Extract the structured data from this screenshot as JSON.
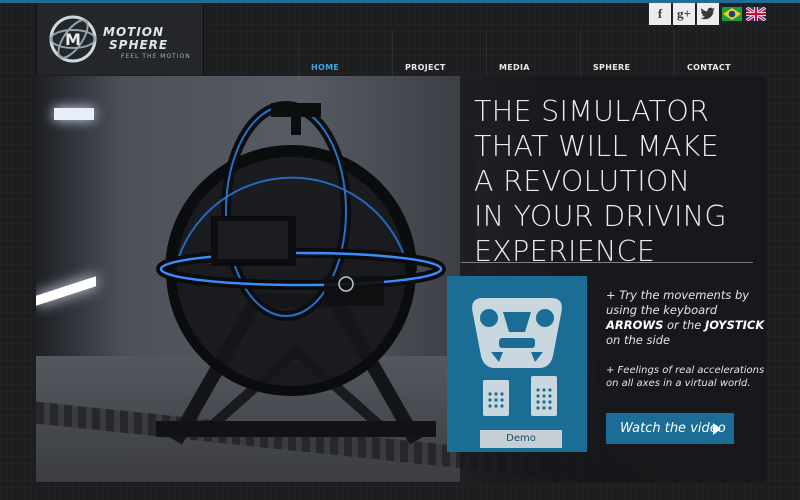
{
  "brand": {
    "line1": "MOTION",
    "line2": "SPHERE",
    "tagline": "FEEL THE MOTION"
  },
  "nav": [
    {
      "label": "HOME",
      "active": true
    },
    {
      "label": "PROJECT",
      "active": false
    },
    {
      "label": "MEDIA",
      "active": false
    },
    {
      "label": "SPHERE",
      "active": false
    },
    {
      "label": "CONTACT",
      "active": false
    }
  ],
  "social": {
    "facebook": "f",
    "googleplus": "g+",
    "twitter": "twitter-icon",
    "lang_br": "brazil-flag-icon",
    "lang_en": "uk-flag-icon"
  },
  "hero": {
    "headline": [
      "THE SIMULATOR",
      "THAT WILL MAKE",
      "A REVOLUTION",
      "IN YOUR DRIVING",
      "EXPERIENCE"
    ],
    "demo_label": "Demo",
    "bullet1_prefix": "+ Try the movements by using the keyboard ",
    "bullet1_keys": "ARROWS",
    "bullet1_mid": " or the ",
    "bullet1_stick": "JOYSTICK",
    "bullet1_suffix": " on the side",
    "bullet2": "+ Feelings of real accelerations on all axes in a virtual world.",
    "watch_label": "Watch the video"
  },
  "colors": {
    "accent": "#1b6d96",
    "nav_active": "#3aa7dc",
    "background": "#1c1d1f"
  }
}
